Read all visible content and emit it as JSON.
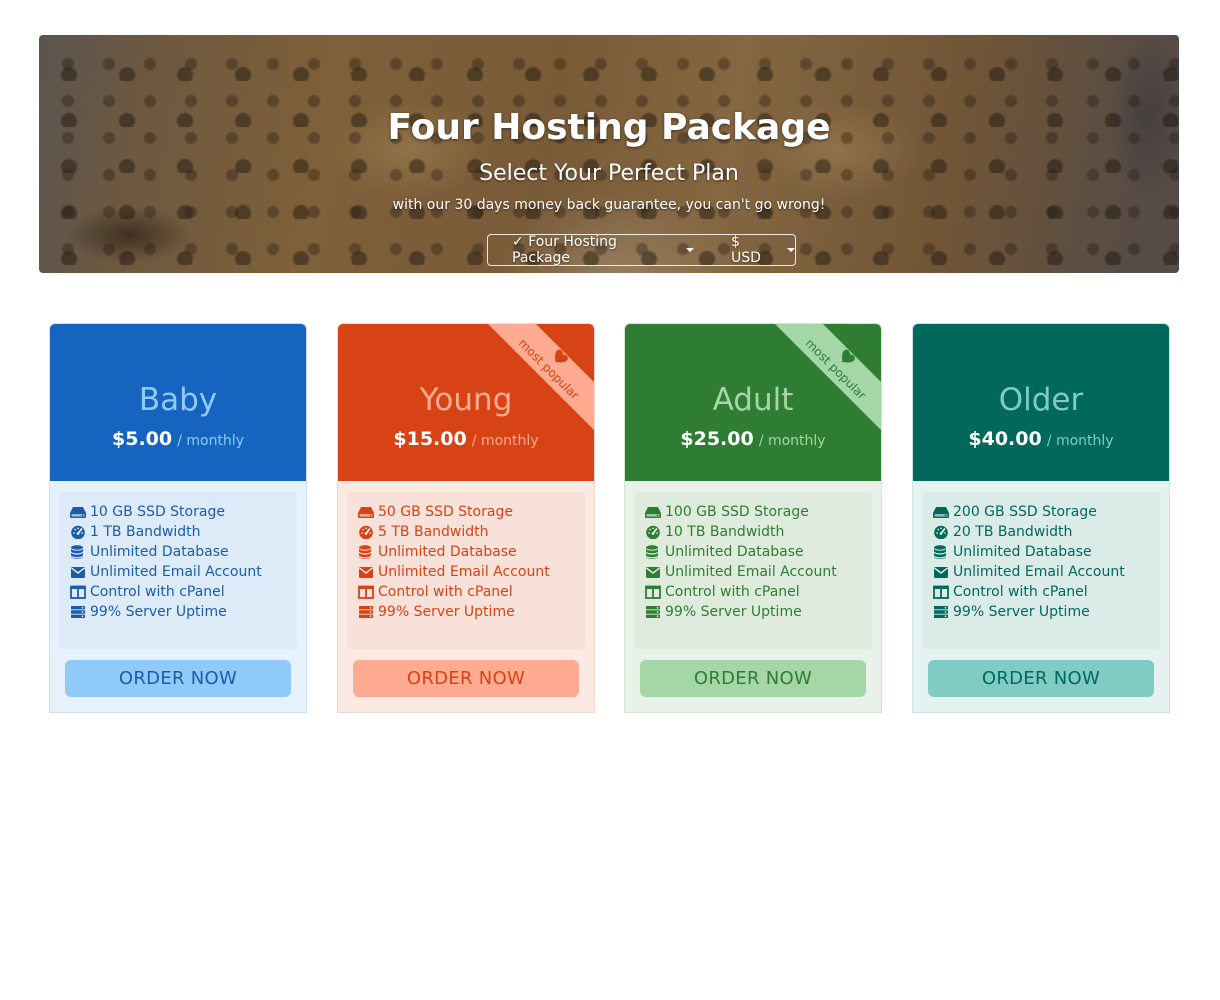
{
  "hero": {
    "title": "Four Hosting Package",
    "subtitle": "Select Your Perfect Plan",
    "tagline": "with our 30 days money back guarantee, you can't go wrong!",
    "package_selector": "✓ Four Hosting Package",
    "currency_selector": "$ USD"
  },
  "plans": [
    {
      "name": "Baby",
      "price": "$5.00",
      "period": "/ monthly",
      "features": [
        "10 GB SSD Storage",
        "1 TB Bandwidth",
        "Unlimited Database",
        "Unlimited Email Account",
        "Control with cPanel",
        "99% Server Uptime"
      ],
      "button": "ORDER NOW",
      "ribbon": "",
      "colors": {
        "header": "#1565c0",
        "name": "#90caf9",
        "period": "#90caf9",
        "body": "#e7f1fb",
        "features_bg": "#ddeaf8",
        "text": "#1d5ca8",
        "button": "#90caf9",
        "button_text": "#1d5ca8",
        "border": "#cddff2"
      }
    },
    {
      "name": "Young",
      "price": "$15.00",
      "period": "/ monthly",
      "features": [
        "50 GB SSD Storage",
        "5 TB Bandwidth",
        "Unlimited Database",
        "Unlimited Email Account",
        "Control with cPanel",
        "99% Server Uptime"
      ],
      "button": "ORDER NOW",
      "ribbon": "most popular",
      "colors": {
        "header": "#d84315",
        "name": "#ffab91",
        "period": "#ffab91",
        "body": "#fbeae4",
        "features_bg": "#f7e1d9",
        "text": "#d84315",
        "button": "#ffab91",
        "button_text": "#d84315",
        "border": "#f3d6cc",
        "ribbon_bg": "#ffab91",
        "ribbon_text": "#d84315"
      }
    },
    {
      "name": "Adult",
      "price": "$25.00",
      "period": "/ monthly",
      "features": [
        "100 GB SSD Storage",
        "10 TB Bandwidth",
        "Unlimited Database",
        "Unlimited Email Account",
        "Control with cPanel",
        "99% Server Uptime"
      ],
      "button": "ORDER NOW",
      "ribbon": "most popular",
      "colors": {
        "header": "#2e7d32",
        "name": "#a5d6a7",
        "period": "#a5d6a7",
        "body": "#e9f2e8",
        "features_bg": "#dfebdd",
        "text": "#2e7d32",
        "button": "#a5d6a7",
        "button_text": "#2e7d32",
        "border": "#d4e6d2",
        "ribbon_bg": "#a5d6a7",
        "ribbon_text": "#2e7d32"
      }
    },
    {
      "name": "Older",
      "price": "$40.00",
      "period": "/ monthly",
      "features": [
        "200 GB SSD Storage",
        "20 TB Bandwidth",
        "Unlimited Database",
        "Unlimited Email Account",
        "Control with cPanel",
        "99% Server Uptime"
      ],
      "button": "ORDER NOW",
      "ribbon": "",
      "colors": {
        "header": "#00695c",
        "name": "#80cbc4",
        "period": "#80cbc4",
        "body": "#e5f2ef",
        "features_bg": "#dbebe8",
        "text": "#00695c",
        "button": "#80cbc4",
        "button_text": "#00695c",
        "border": "#cfe5e1"
      }
    }
  ],
  "feature_icons": [
    "hdd-icon",
    "speedometer-icon",
    "database-icon",
    "envelope-icon",
    "columns-icon",
    "server-icon"
  ]
}
